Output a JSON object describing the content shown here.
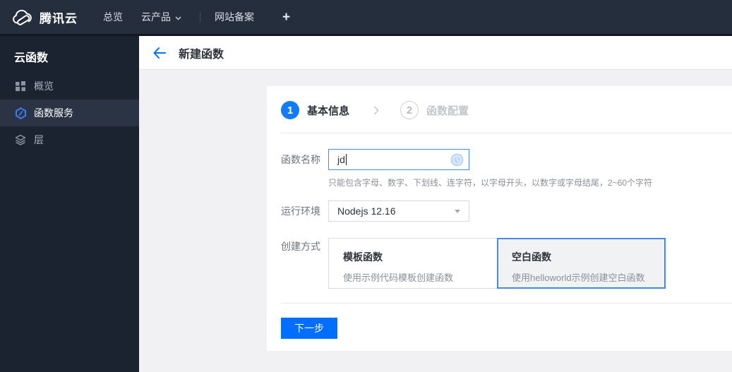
{
  "topbar": {
    "brand": "腾讯云",
    "nav_overview": "总览",
    "nav_products": "云产品",
    "nav_icp": "网站备案",
    "plus": "+"
  },
  "sidebar": {
    "title": "云函数",
    "items": [
      {
        "label": "概览",
        "icon": "grid-icon",
        "selected": false
      },
      {
        "label": "函数服务",
        "icon": "scf-hexagon-icon",
        "selected": true
      },
      {
        "label": "层",
        "icon": "layers-icon",
        "selected": false
      }
    ]
  },
  "header": {
    "title": "新建函数"
  },
  "wizard": {
    "steps": [
      {
        "number": "1",
        "label": "基本信息",
        "active": true
      },
      {
        "number": "2",
        "label": "函数配置",
        "active": false
      }
    ]
  },
  "form": {
    "name_label": "函数名称",
    "name_value": "jd",
    "name_hint": "只能包含字母、数字、下划线、连字符，以字母开头，以数字或字母结尾，2~60个字符",
    "runtime_label": "运行环境",
    "runtime_value": "Nodejs 12.16",
    "method_label": "创建方式",
    "methods": [
      {
        "title": "模板函数",
        "desc": "使用示例代码模板创建函数",
        "selected": false
      },
      {
        "title": "空白函数",
        "desc": "使用helloworld示例创建空白函数",
        "selected": true
      }
    ]
  },
  "actions": {
    "next": "下一步"
  },
  "colors": {
    "primary": "#006eff",
    "step_active": "#127cf8",
    "input_focus_border": "#4787e6",
    "topbar_bg": "#252e3c",
    "sidebar_bg": "#1c2330",
    "sidebar_selected_bg": "#2b3445",
    "content_bg": "#f1f1f3"
  }
}
